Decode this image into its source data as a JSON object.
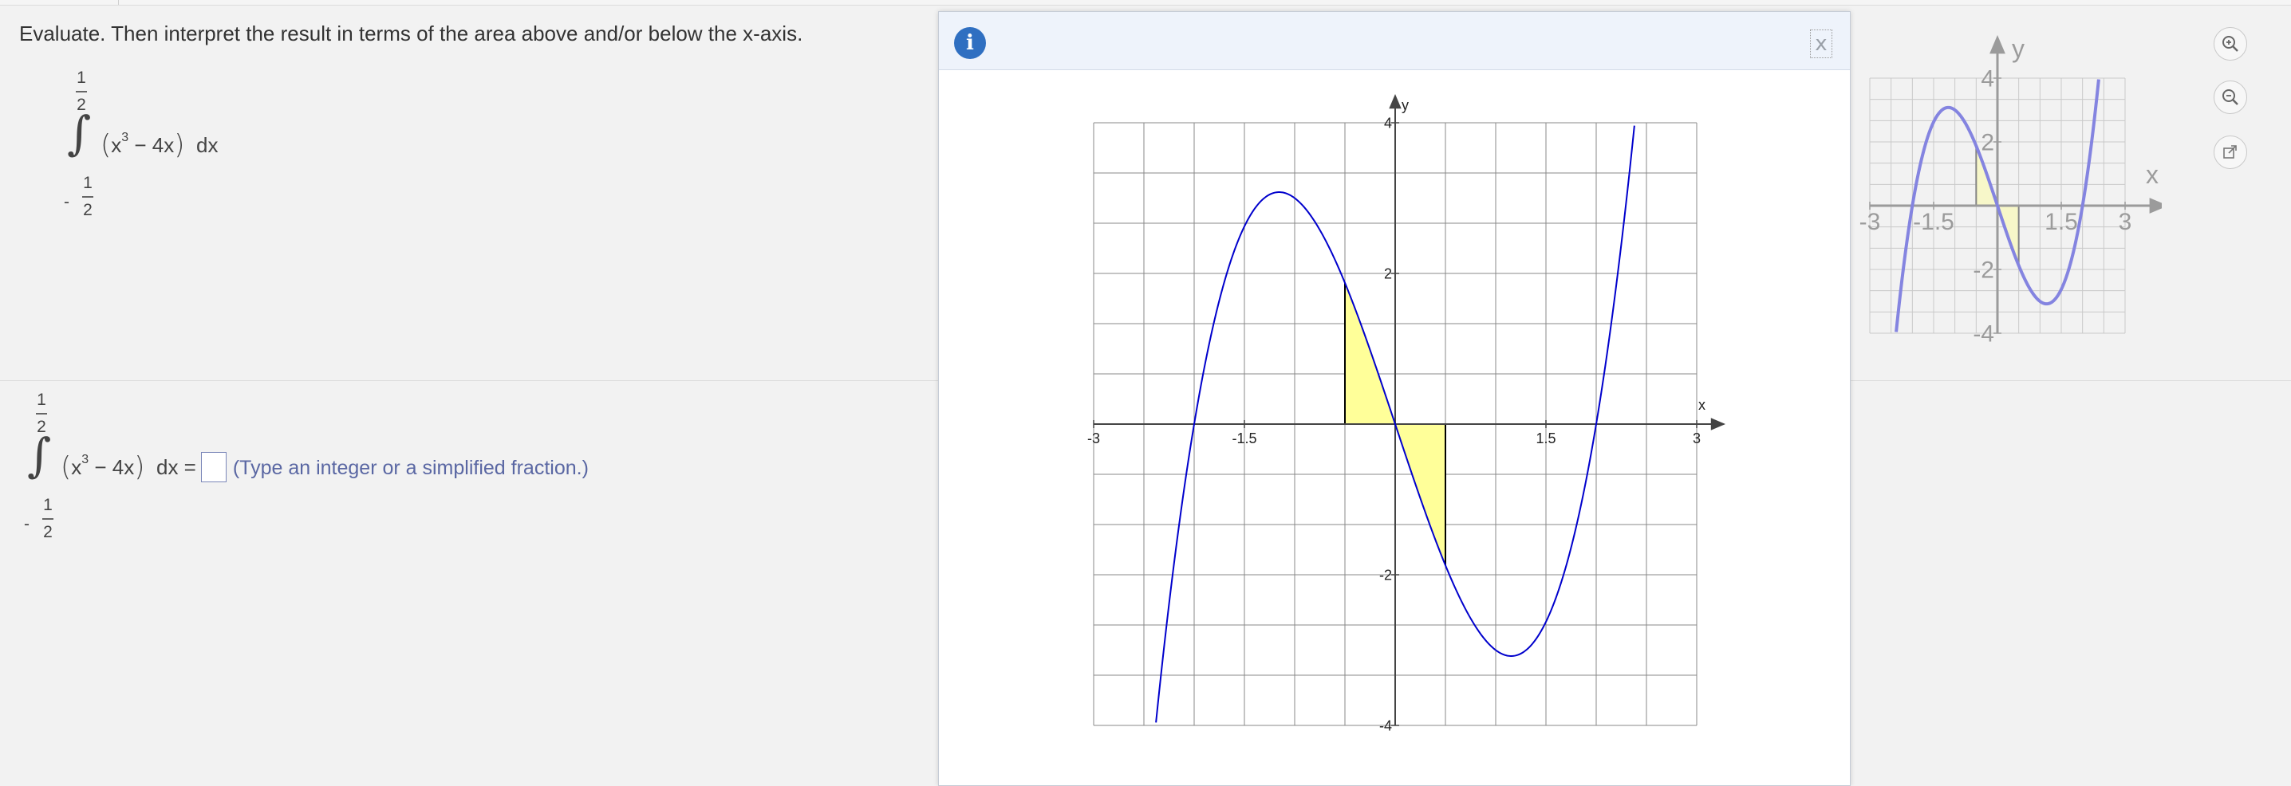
{
  "question": {
    "text": "Evaluate. Then interpret the result in terms of the area above and/or below the x-axis."
  },
  "integral": {
    "upper_num": "1",
    "upper_den": "2",
    "lower_sign": "-",
    "lower_num": "1",
    "lower_den": "2",
    "var": "x",
    "exponent": "3",
    "rest": " − 4x",
    "dx": "dx"
  },
  "answer": {
    "equals": "dx =",
    "hint": "(Type an integer or a simplified fraction.)",
    "value": ""
  },
  "dialog": {
    "info_icon": "i",
    "close_label": "x"
  },
  "main_graph": {
    "xlabel": "x",
    "ylabel": "y",
    "x_ticks": [
      "-3",
      "-1.5",
      "1.5",
      "3"
    ],
    "y_ticks": [
      "4",
      "2",
      "-2",
      "-4"
    ]
  },
  "side_graph": {
    "xlabel": "x",
    "ylabel": "y",
    "x_ticks": [
      "-3",
      "-1.5",
      "1.5",
      "3"
    ],
    "y_ticks": [
      "4",
      "2",
      "-2",
      "-4"
    ]
  },
  "chart_data": {
    "type": "line",
    "function": "x^3 - 4x",
    "xlim": [
      -3,
      3
    ],
    "ylim": [
      -4,
      4
    ],
    "grid": true,
    "shaded_intervals": [
      [
        -0.5,
        0
      ],
      [
        0,
        0.5
      ]
    ],
    "shade_color": "#ffff99",
    "curve_color": "#0000cc"
  },
  "tools": {
    "zoom_in": "zoom-in-icon",
    "zoom_out": "zoom-out-icon",
    "popout": "popout-icon"
  }
}
